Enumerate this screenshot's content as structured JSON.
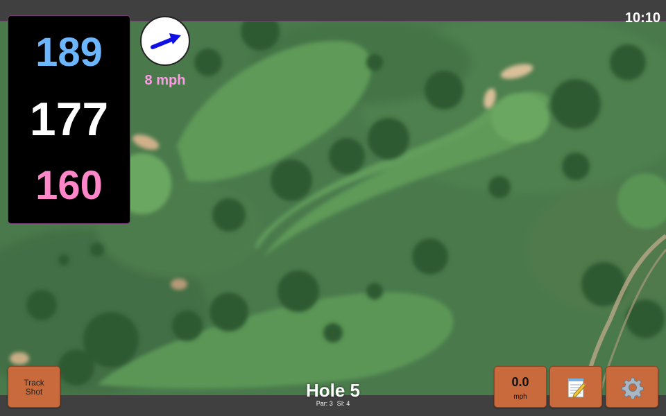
{
  "status": {
    "clock": "10:10"
  },
  "yardages": {
    "back": "189",
    "center": "177",
    "front": "160",
    "back_color": "#6cb6ff",
    "center_color": "#ffffff",
    "front_color": "#ff86c8"
  },
  "wind": {
    "speed_label": "8 mph",
    "arrow_color": "#1010e6",
    "direction_icon": "wind-arrow-icon"
  },
  "buttons": {
    "track_shot_line1": "Track",
    "track_shot_line2": "Shot",
    "speed_value": "0.0",
    "speed_unit": "mph",
    "notes_icon": "notepad-icon",
    "settings_icon": "gear-icon",
    "button_color": "#c96a3c"
  },
  "hole": {
    "title": "Hole 5",
    "par": "Par: 3",
    "si": "SI: 4"
  },
  "map": {
    "type": "satellite-aerial-golf-course"
  }
}
